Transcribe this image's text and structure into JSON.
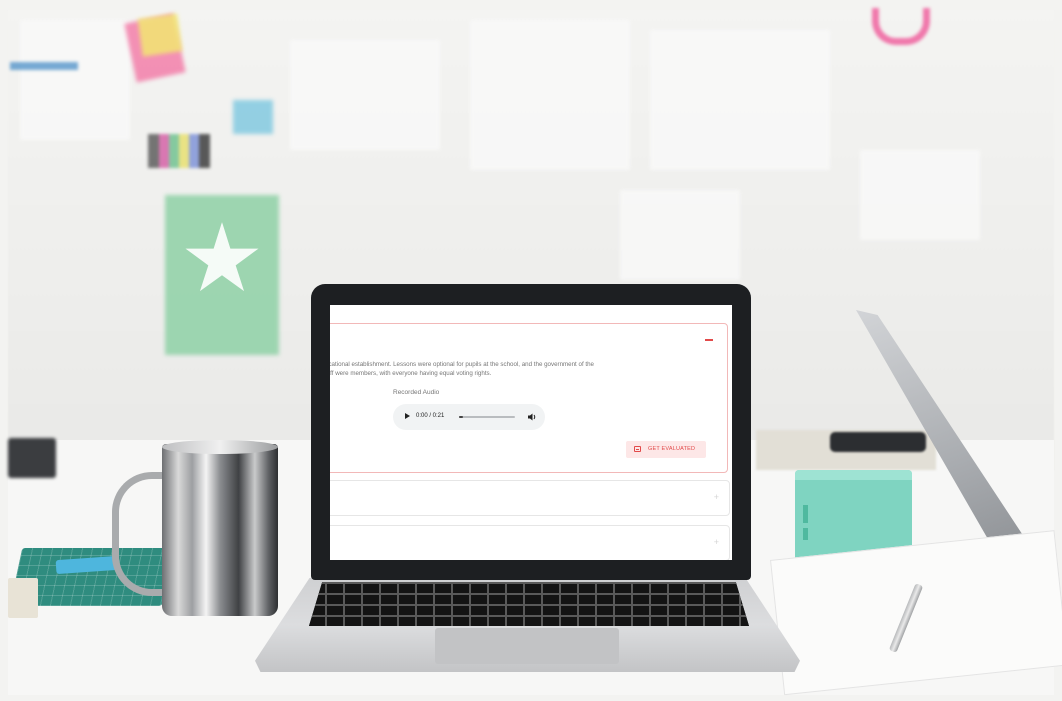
{
  "question": {
    "text_line1": "ucational establishment. Lessons were optional for pupils at the school, and the government of the",
    "text_line2": "taff were members, with everyone having equal voting rights."
  },
  "audio": {
    "label": "Recorded Audio",
    "time": "0:00 / 0:21",
    "progress": 0.0
  },
  "actions": {
    "get_evaluated": "GET EVALUATED"
  },
  "accordion": {
    "expanded_toggle": "−",
    "collapsed_toggle": "+"
  },
  "icons": {
    "collapse": "minus-icon",
    "expand": "plus-icon",
    "play": "play-icon",
    "volume": "volume-icon",
    "evaluate": "document-icon"
  },
  "colors": {
    "accent": "#e24a4a",
    "accent_bg": "#fde7e7",
    "panel_border": "#f2b8b8",
    "player_bg": "#f1f3f4"
  }
}
